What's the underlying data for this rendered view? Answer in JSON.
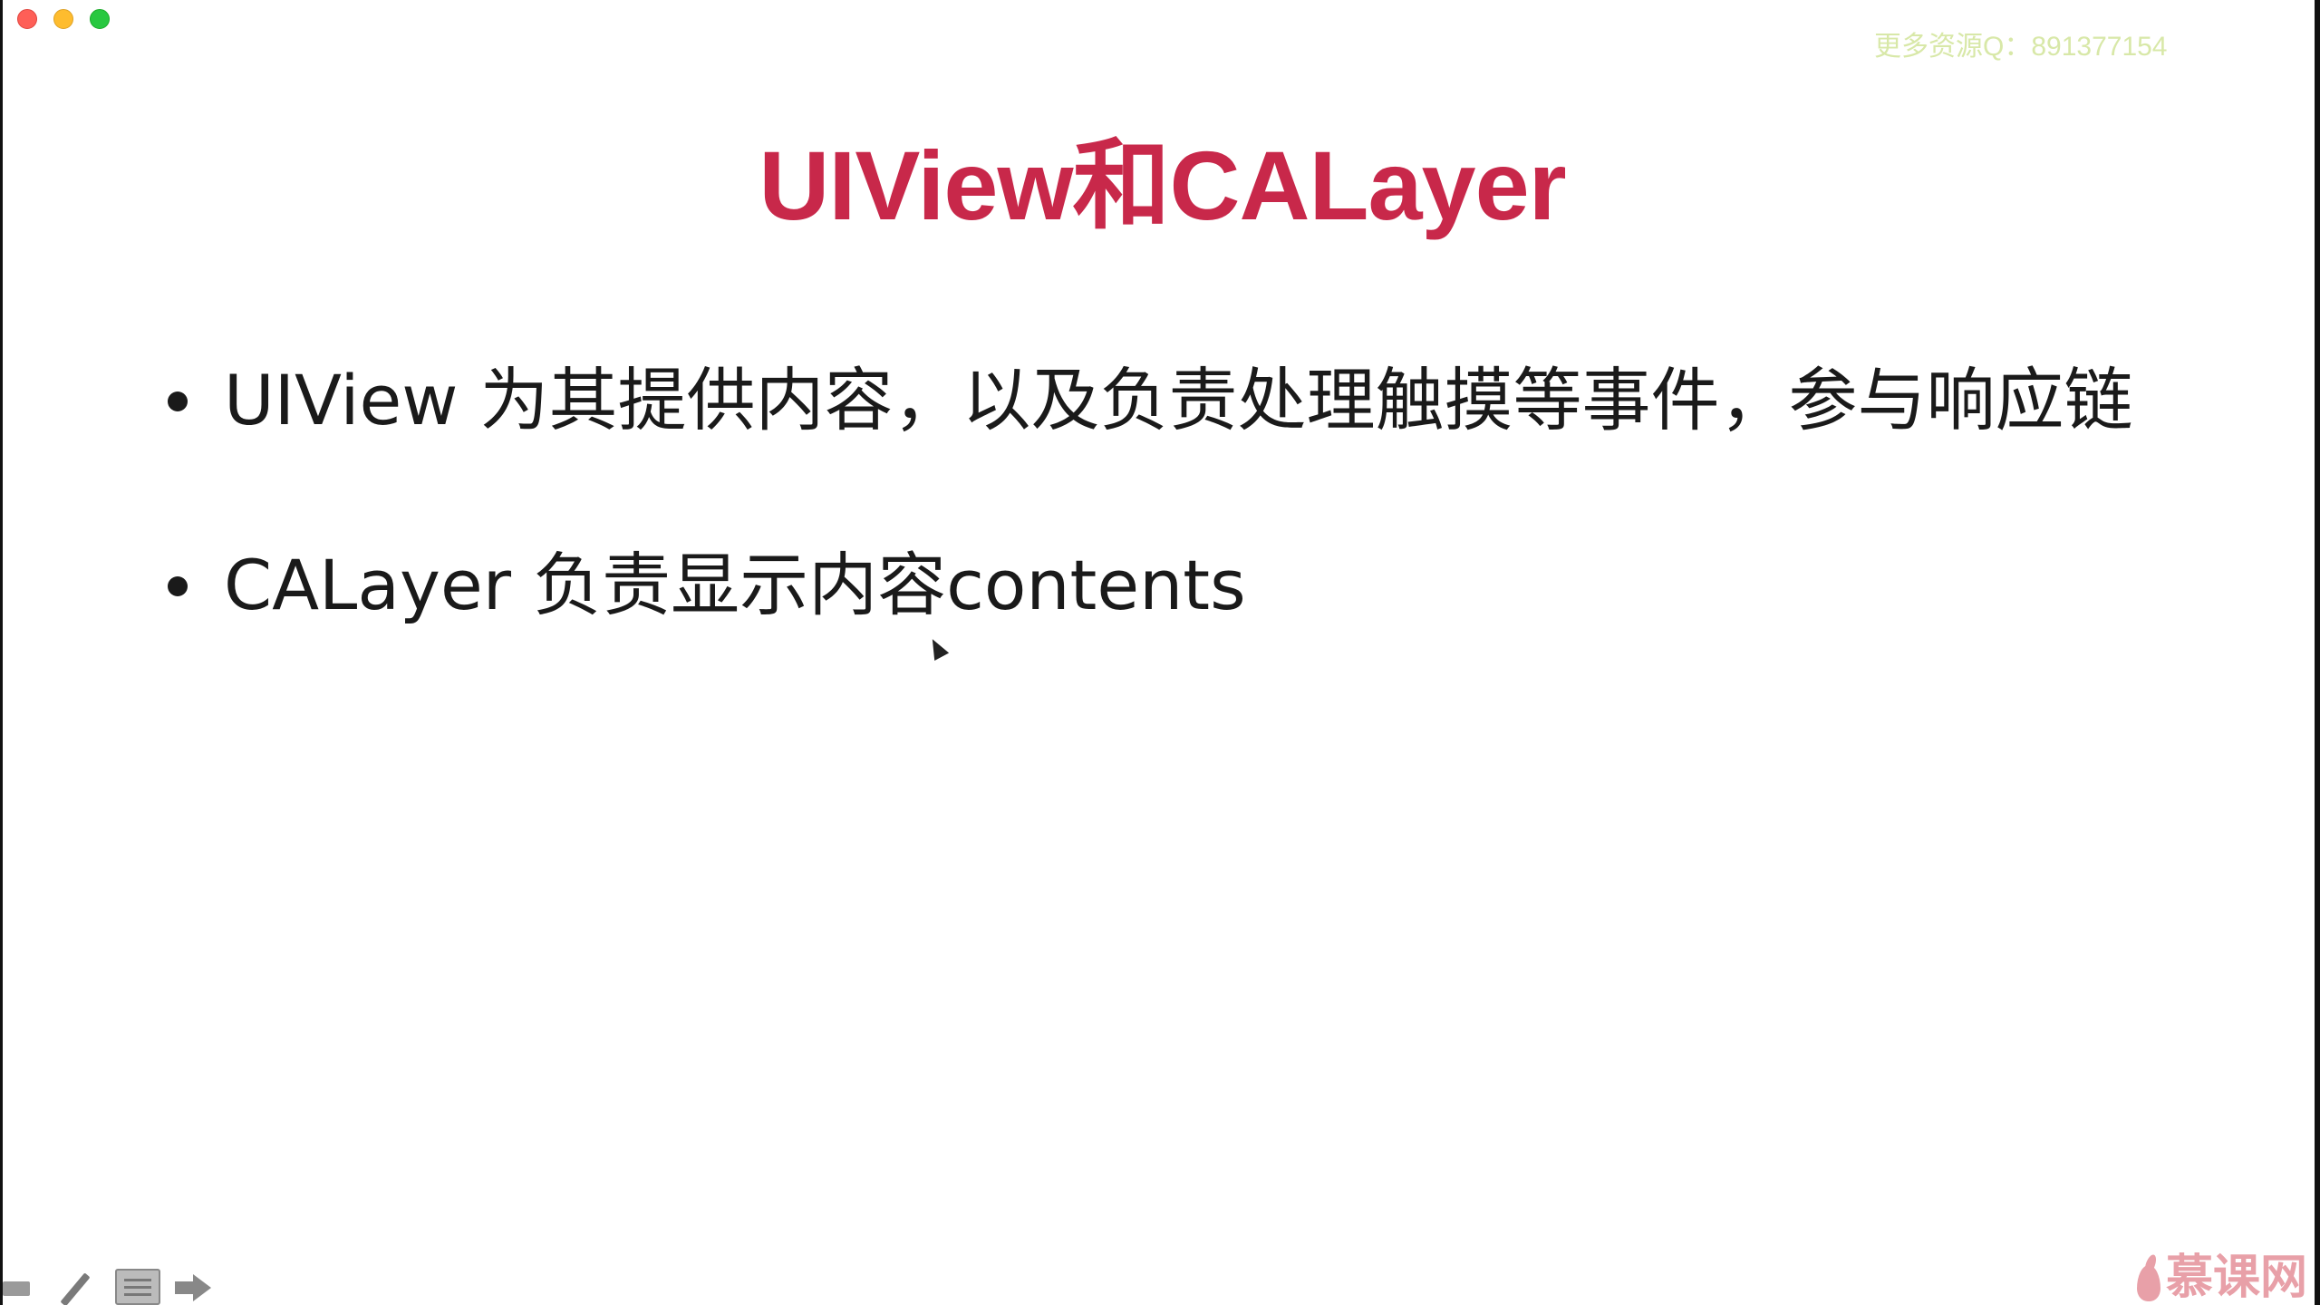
{
  "window": {
    "controls": [
      "close",
      "minimize",
      "maximize"
    ]
  },
  "watermark": "更多资源Q：891377154",
  "slide": {
    "title": "UIView和CALayer",
    "bullets": [
      "UIView 为其提供内容，以及负责处理触摸等事件，参与响应链",
      "CALayer 负责显示内容contents"
    ]
  },
  "toolbar": {
    "icons": [
      "previous-icon",
      "pen-icon",
      "menu-icon",
      "next-icon"
    ]
  },
  "brand": {
    "text": "慕课网",
    "color": "#e8a0a8"
  },
  "colors": {
    "title": "#c8284a",
    "body_text": "#1a1a1a",
    "watermark": "#d8e8a8"
  }
}
